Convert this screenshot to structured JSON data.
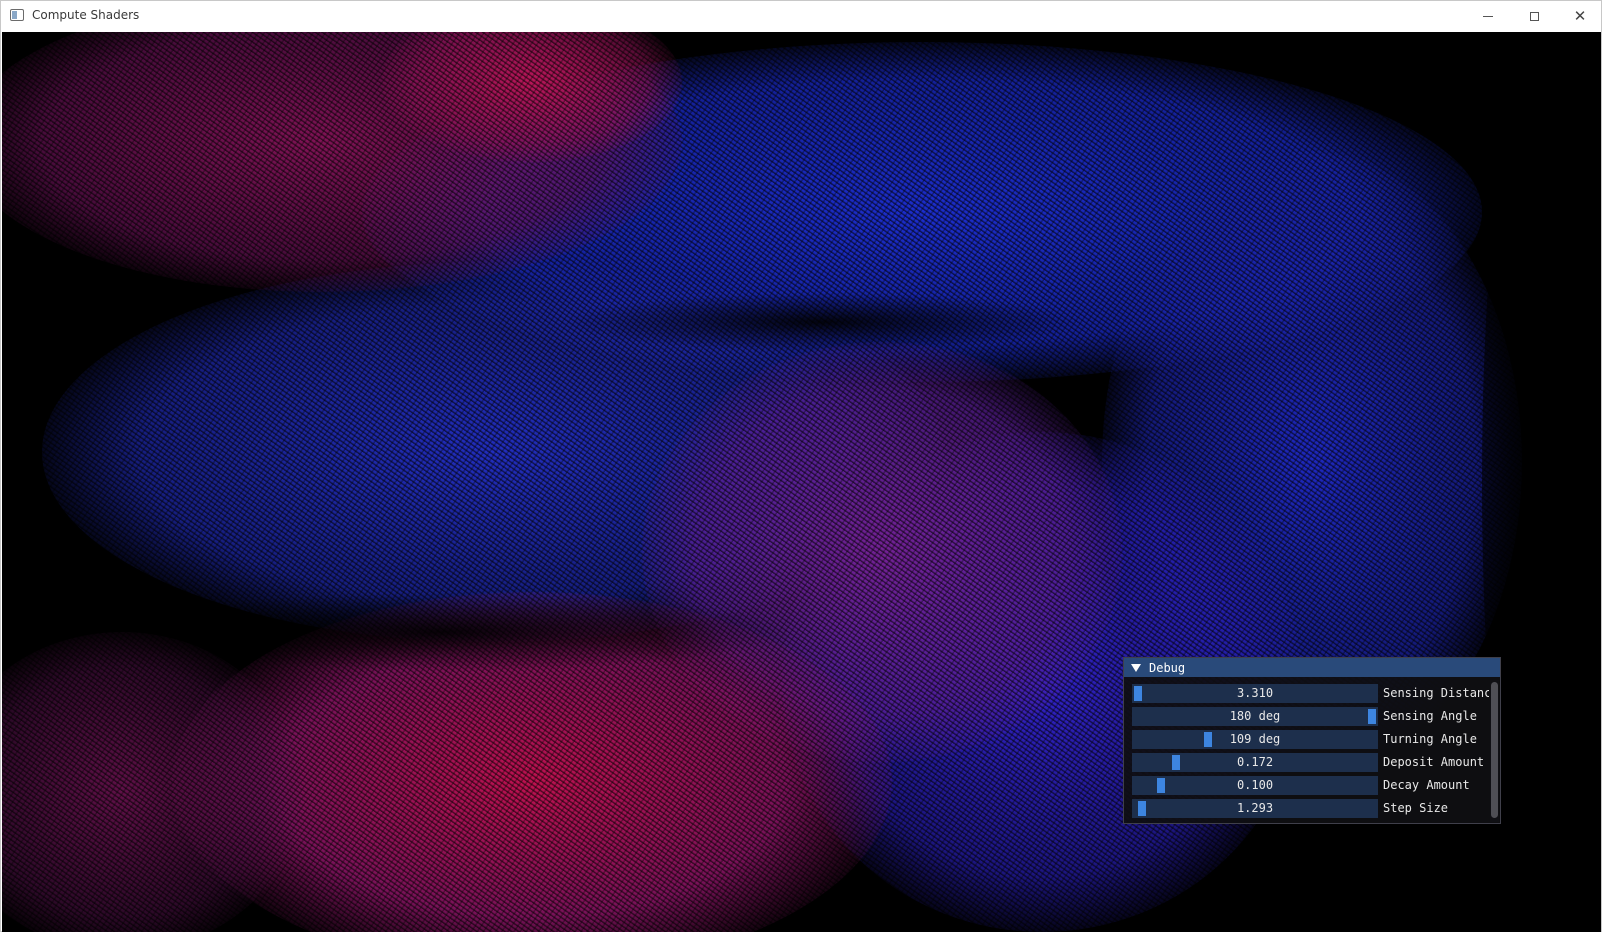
{
  "window": {
    "title": "Compute Shaders",
    "icon": "app-window-icon",
    "controls": [
      "minimize-icon",
      "maximize-icon",
      "close-icon"
    ]
  },
  "canvas": {
    "description_colors": {
      "blue": "#1f2fe0",
      "magenta": "#c4145a",
      "purple": "#6b22a8",
      "background": "#000000"
    }
  },
  "debug": {
    "title": "Debug",
    "rows": [
      {
        "label": "Sensing Distanc",
        "value": "3.310",
        "level": 0.02
      },
      {
        "label": "Sensing Angle",
        "value": "180 deg",
        "level": 1.0
      },
      {
        "label": "Turning Angle",
        "value": "109 deg",
        "level": 0.3
      },
      {
        "label": "Deposit Amount",
        "value": "0.172",
        "level": 0.17
      },
      {
        "label": "Decay Amount",
        "value": "0.100",
        "level": 0.1
      },
      {
        "label": "Step Size",
        "value": "1.293",
        "level": 0.02
      }
    ]
  }
}
